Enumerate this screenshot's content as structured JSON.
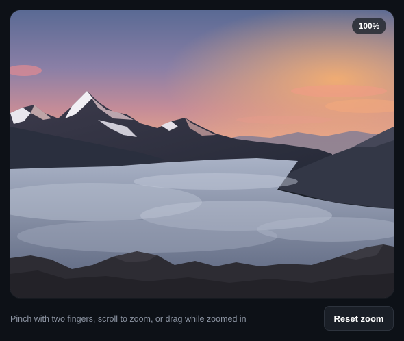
{
  "viewer": {
    "zoom_label": "100%",
    "image_subject": "mountain-sunset-sea-of-clouds"
  },
  "footer": {
    "hint_text": "Pinch with two fingers, scroll to zoom, or drag while zoomed in",
    "reset_label": "Reset zoom"
  },
  "colors": {
    "page_background": "#0d1117",
    "button_background": "#1a1f27",
    "hint_text": "#8b93a1"
  }
}
